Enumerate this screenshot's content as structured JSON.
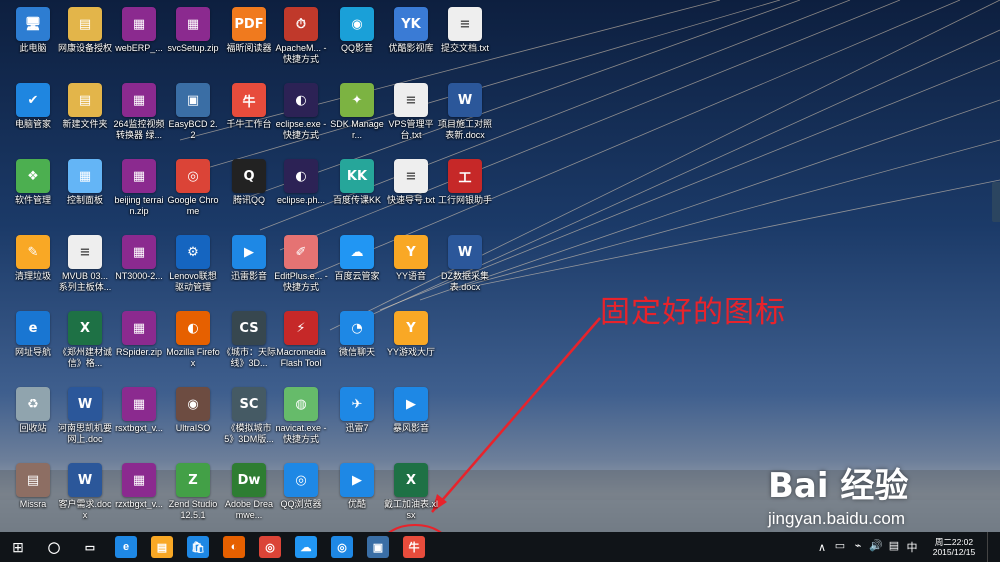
{
  "desktop": {
    "icons": [
      {
        "label": "此电脑",
        "color": "#2d7dd2",
        "glyph": "🖥",
        "col": 0,
        "row": 0
      },
      {
        "label": "网康设备授权",
        "color": "#e3b54a",
        "glyph": "▤",
        "col": 1,
        "row": 0
      },
      {
        "label": "webERP_...",
        "color": "#8b2a8f",
        "glyph": "▦",
        "col": 2,
        "row": 0
      },
      {
        "label": "svcSetup.zip",
        "color": "#8b2a8f",
        "glyph": "▦",
        "col": 3,
        "row": 0
      },
      {
        "label": "福昕阅读器",
        "color": "#f07a1e",
        "glyph": "PDF",
        "col": 4,
        "row": 0
      },
      {
        "label": "ApacheM... - 快捷方式",
        "color": "#c0392b",
        "glyph": "⏱",
        "col": 5,
        "row": 0
      },
      {
        "label": "QQ影音",
        "color": "#1aa0d8",
        "glyph": "◉",
        "col": 6,
        "row": 0
      },
      {
        "label": "优酷影视库",
        "color": "#3a7bd5",
        "glyph": "YK",
        "col": 7,
        "row": 0
      },
      {
        "label": "提交文档.txt",
        "color": "#eeeeee",
        "glyph": "≡",
        "col": 8,
        "row": 0
      },
      {
        "label": "电脑管家",
        "color": "#1f86e0",
        "glyph": "✔",
        "col": 0,
        "row": 1
      },
      {
        "label": "新建文件夹",
        "color": "#e3b54a",
        "glyph": "▤",
        "col": 1,
        "row": 1
      },
      {
        "label": "264监控视频转换器 绿...",
        "color": "#8b2a8f",
        "glyph": "▦",
        "col": 2,
        "row": 1
      },
      {
        "label": "EasyBCD 2.2",
        "color": "#3a6ea5",
        "glyph": "▣",
        "col": 3,
        "row": 1
      },
      {
        "label": "千牛工作台",
        "color": "#e74c3c",
        "glyph": "牛",
        "col": 4,
        "row": 1
      },
      {
        "label": "eclipse.exe - 快捷方式",
        "color": "#2c2255",
        "glyph": "◐",
        "col": 5,
        "row": 1
      },
      {
        "label": "SDK Manager...",
        "color": "#7cb342",
        "glyph": "✦",
        "col": 6,
        "row": 1
      },
      {
        "label": "VPS管理平台.txt",
        "color": "#eeeeee",
        "glyph": "≡",
        "col": 7,
        "row": 1
      },
      {
        "label": "项目施工对照表新.docx",
        "color": "#2b579a",
        "glyph": "W",
        "col": 8,
        "row": 1
      },
      {
        "label": "软件管理",
        "color": "#4caf50",
        "glyph": "❖",
        "col": 0,
        "row": 2
      },
      {
        "label": "控制面板",
        "color": "#64b5f6",
        "glyph": "▦",
        "col": 1,
        "row": 2
      },
      {
        "label": "beijing terrain.zip",
        "color": "#8b2a8f",
        "glyph": "▦",
        "col": 2,
        "row": 2
      },
      {
        "label": "Google Chrome",
        "color": "#db4437",
        "glyph": "◎",
        "col": 3,
        "row": 2
      },
      {
        "label": "腾讯QQ",
        "color": "#222222",
        "glyph": "Q",
        "col": 4,
        "row": 2
      },
      {
        "label": "eclipse.ph...",
        "color": "#2c2255",
        "glyph": "◐",
        "col": 5,
        "row": 2
      },
      {
        "label": "百度传课KK",
        "color": "#26a69a",
        "glyph": "KK",
        "col": 6,
        "row": 2
      },
      {
        "label": "快速导号.txt",
        "color": "#eeeeee",
        "glyph": "≡",
        "col": 7,
        "row": 2
      },
      {
        "label": "工行网银助手",
        "color": "#c62828",
        "glyph": "工",
        "col": 8,
        "row": 2
      },
      {
        "label": "清理垃圾",
        "color": "#f9a825",
        "glyph": "✎",
        "col": 0,
        "row": 3
      },
      {
        "label": "MVUB 03... 系列主板体...",
        "color": "#eeeeee",
        "glyph": "≡",
        "col": 1,
        "row": 3
      },
      {
        "label": "NT3000-2...",
        "color": "#8b2a8f",
        "glyph": "▦",
        "col": 2,
        "row": 3
      },
      {
        "label": "Lenovo联想驱动管理",
        "color": "#1565c0",
        "glyph": "⚙",
        "col": 3,
        "row": 3
      },
      {
        "label": "迅雷影音",
        "color": "#1e88e5",
        "glyph": "▶",
        "col": 4,
        "row": 3
      },
      {
        "label": "EditPlus.e... - 快捷方式",
        "color": "#e57373",
        "glyph": "✐",
        "col": 5,
        "row": 3
      },
      {
        "label": "百度云管家",
        "color": "#2196f3",
        "glyph": "☁",
        "col": 6,
        "row": 3
      },
      {
        "label": "YY语音",
        "color": "#f9a825",
        "glyph": "Y",
        "col": 7,
        "row": 3
      },
      {
        "label": "DZ数据采集表.docx",
        "color": "#2b579a",
        "glyph": "W",
        "col": 8,
        "row": 3
      },
      {
        "label": "网址导航",
        "color": "#1976d2",
        "glyph": "e",
        "col": 0,
        "row": 4
      },
      {
        "label": "《郑州建材诚信》格...",
        "color": "#1e7145",
        "glyph": "X",
        "col": 1,
        "row": 4
      },
      {
        "label": "RSpider.zip",
        "color": "#8b2a8f",
        "glyph": "▦",
        "col": 2,
        "row": 4
      },
      {
        "label": "Mozilla Firefox",
        "color": "#e66000",
        "glyph": "◐",
        "col": 3,
        "row": 4
      },
      {
        "label": "《城市：天际线》3D...",
        "color": "#37474f",
        "glyph": "CS",
        "col": 4,
        "row": 4
      },
      {
        "label": "Macromedia Flash Tool",
        "color": "#c62828",
        "glyph": "⚡",
        "col": 5,
        "row": 4
      },
      {
        "label": "微信聊天",
        "color": "#1e88e5",
        "glyph": "◔",
        "col": 6,
        "row": 4
      },
      {
        "label": "YY游戏大厅",
        "color": "#f9a825",
        "glyph": "Y",
        "col": 7,
        "row": 4
      },
      {
        "label": "回收站",
        "color": "#90a4ae",
        "glyph": "♻",
        "col": 0,
        "row": 5
      },
      {
        "label": "河南思凯机要网上.doc",
        "color": "#2b579a",
        "glyph": "W",
        "col": 1,
        "row": 5
      },
      {
        "label": "rsxtbgxt_v...",
        "color": "#8b2a8f",
        "glyph": "▦",
        "col": 2,
        "row": 5
      },
      {
        "label": "UltraISO",
        "color": "#6d4c41",
        "glyph": "◉",
        "col": 3,
        "row": 5
      },
      {
        "label": "《模拟城市5》3DM版...",
        "color": "#455a64",
        "glyph": "SC",
        "col": 4,
        "row": 5
      },
      {
        "label": "navicat.exe - 快捷方式",
        "color": "#66bb6a",
        "glyph": "◍",
        "col": 5,
        "row": 5
      },
      {
        "label": "迅雷7",
        "color": "#1e88e5",
        "glyph": "✈",
        "col": 6,
        "row": 5
      },
      {
        "label": "暴风影音",
        "color": "#1e88e5",
        "glyph": "▶",
        "col": 7,
        "row": 5
      },
      {
        "label": "Missra",
        "color": "#8d6e63",
        "glyph": "▤",
        "col": 0,
        "row": 6
      },
      {
        "label": "客户需求.docx",
        "color": "#2b579a",
        "glyph": "W",
        "col": 1,
        "row": 6
      },
      {
        "label": "rzxtbgxt_v...",
        "color": "#8b2a8f",
        "glyph": "▦",
        "col": 2,
        "row": 6
      },
      {
        "label": "Zend Studio 12.5.1",
        "color": "#43a047",
        "glyph": "Z",
        "col": 3,
        "row": 6
      },
      {
        "label": "Adobe Dreamwe...",
        "color": "#2e7d32",
        "glyph": "Dw",
        "col": 4,
        "row": 6
      },
      {
        "label": "QQ浏览器",
        "color": "#1e88e5",
        "glyph": "◎",
        "col": 5,
        "row": 6
      },
      {
        "label": "优酷",
        "color": "#1e88e5",
        "glyph": "▶",
        "col": 6,
        "row": 6
      },
      {
        "label": "戴工加油表.xlsx",
        "color": "#1e7145",
        "glyph": "X",
        "col": 7,
        "row": 6
      }
    ]
  },
  "annotation": {
    "text": "固定好的图标"
  },
  "watermark": {
    "brand": "Bai 经验",
    "url": "jingyan.baidu.com"
  },
  "taskbar": {
    "start_icon": "⊞",
    "items": [
      {
        "name": "search",
        "glyph": "◯",
        "color": "transparent"
      },
      {
        "name": "task-view",
        "glyph": "▭",
        "color": "transparent"
      },
      {
        "name": "edge",
        "glyph": "e",
        "color": "#1e88e5"
      },
      {
        "name": "file-explorer",
        "glyph": "▤",
        "color": "#f9a825"
      },
      {
        "name": "store",
        "glyph": "🛍",
        "color": "#1e88e5"
      },
      {
        "name": "firefox",
        "glyph": "◐",
        "color": "#e66000"
      },
      {
        "name": "chrome",
        "glyph": "◎",
        "color": "#db4437"
      },
      {
        "name": "baidu-cloud",
        "glyph": "☁",
        "color": "#2196f3"
      },
      {
        "name": "qq-browser",
        "glyph": "◎",
        "color": "#1e88e5"
      },
      {
        "name": "easybcd",
        "glyph": "▣",
        "color": "#3a6ea5"
      },
      {
        "name": "qianniu",
        "glyph": "牛",
        "color": "#e74c3c"
      }
    ],
    "tray": {
      "chevron": "∧",
      "icons": [
        "▭",
        "⌁",
        "🔊",
        "▤",
        "中"
      ],
      "time": "周二22:02",
      "date": "2015/12/15"
    }
  },
  "colors": {
    "annotation_red": "#e8232b",
    "taskbar": "#101418"
  }
}
